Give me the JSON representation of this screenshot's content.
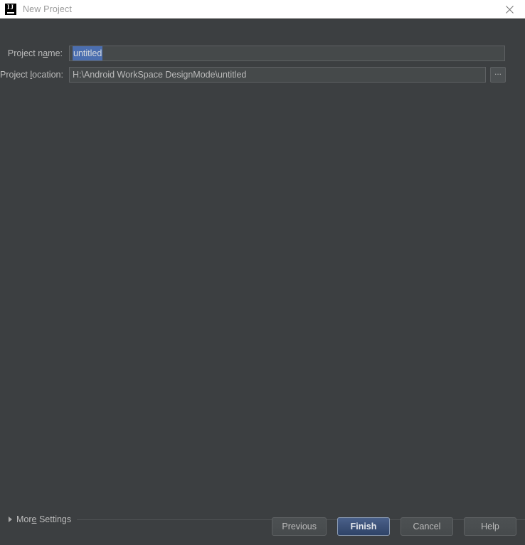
{
  "window": {
    "title": "New Project",
    "app_icon": "intellij-idea-icon",
    "close_icon": "close-icon"
  },
  "form": {
    "project_name": {
      "label_pre": "Project n",
      "label_mnemonic": "a",
      "label_post": "me:",
      "label_full": "Project name:",
      "value": "untitled",
      "placeholder": "untitled",
      "selected": true
    },
    "project_location": {
      "label_pre": "Project ",
      "label_mnemonic": "l",
      "label_post": "ocation:",
      "label_full": "Project location:",
      "value": "H:\\Android WorkSpace DesignMode\\untitled",
      "placeholder": "H:\\Android WorkSpace DesignMode\\untitled",
      "browse_label": "...",
      "browse_icon": "ellipsis-icon"
    }
  },
  "more_settings": {
    "label_pre": "Mor",
    "label_mnemonic": "e",
    "label_post": " Settings",
    "label_full": "More Settings",
    "expanded": false,
    "toggle_icon": "chevron-right-icon"
  },
  "buttons": {
    "previous": "Previous",
    "finish": "Finish",
    "cancel": "Cancel",
    "help": "Help",
    "default_button": "Finish"
  },
  "colors": {
    "titlebar_bg": "#ffffff",
    "dialog_bg": "#3c3f41",
    "field_bg": "#45494a",
    "field_border": "#5e6163",
    "text": "#bbbbbb",
    "title_text": "#9a9a9a",
    "selection_bg": "#4b6eaf",
    "default_button_bg": "#3d5279",
    "default_button_border": "#8c9cb4"
  }
}
